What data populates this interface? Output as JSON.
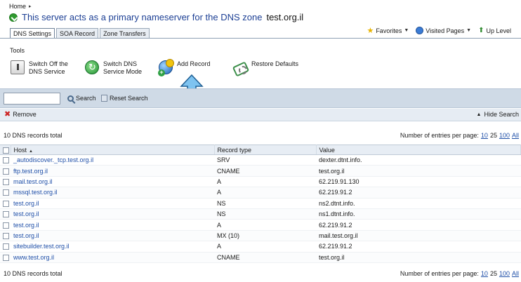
{
  "breadcrumb": {
    "home": "Home",
    "sep": "▸"
  },
  "title": {
    "text": "This server acts as a primary nameserver for the DNS zone",
    "zone": "test.org.il"
  },
  "tabs": [
    {
      "label": "DNS Settings",
      "active": true
    },
    {
      "label": "SOA Record",
      "active": false
    },
    {
      "label": "Zone Transfers",
      "active": false
    }
  ],
  "top_actions": {
    "favorites": "Favorites",
    "visited": "Visited Pages",
    "up": "Up Level"
  },
  "tools": {
    "title": "Tools",
    "items": [
      {
        "line1": "Switch Off the",
        "line2": "DNS Service",
        "icon": "power-switch-icon"
      },
      {
        "line1": "Switch DNS",
        "line2": "Service Mode",
        "icon": "switch-mode-icon"
      },
      {
        "line1": "Add Record",
        "line2": "",
        "icon": "add-record-icon"
      },
      {
        "line1": "Restore Defaults",
        "line2": "",
        "icon": "restore-defaults-icon"
      }
    ]
  },
  "search": {
    "value": "",
    "placeholder": "",
    "search_label": "Search",
    "reset_label": "Reset Search"
  },
  "actions": {
    "remove_label": "Remove",
    "hide_search_label": "Hide Search"
  },
  "summary": {
    "total_text": "10 DNS records total",
    "per_page_label": "Number of entries per page:",
    "options": [
      "10",
      "25",
      "100",
      "All"
    ],
    "current": "25"
  },
  "table": {
    "headers": {
      "host": "Host",
      "type": "Record type",
      "value": "Value"
    },
    "rows": [
      {
        "host": "_autodiscover._tcp.test.org.il",
        "type": "SRV",
        "value": "dexter.dtnt.info."
      },
      {
        "host": "ftp.test.org.il",
        "type": "CNAME",
        "value": "test.org.il"
      },
      {
        "host": "mail.test.org.il",
        "type": "A",
        "value": "62.219.91.130"
      },
      {
        "host": "mssql.test.org.il",
        "type": "A",
        "value": "62.219.91.2"
      },
      {
        "host": "test.org.il",
        "type": "NS",
        "value": "ns2.dtnt.info."
      },
      {
        "host": "test.org.il",
        "type": "NS",
        "value": "ns1.dtnt.info."
      },
      {
        "host": "test.org.il",
        "type": "A",
        "value": "62.219.91.2"
      },
      {
        "host": "test.org.il",
        "type": "MX (10)",
        "value": "mail.test.org.il"
      },
      {
        "host": "sitebuilder.test.org.il",
        "type": "A",
        "value": "62.219.91.2"
      },
      {
        "host": "www.test.org.il",
        "type": "CNAME",
        "value": "test.org.il"
      }
    ]
  }
}
